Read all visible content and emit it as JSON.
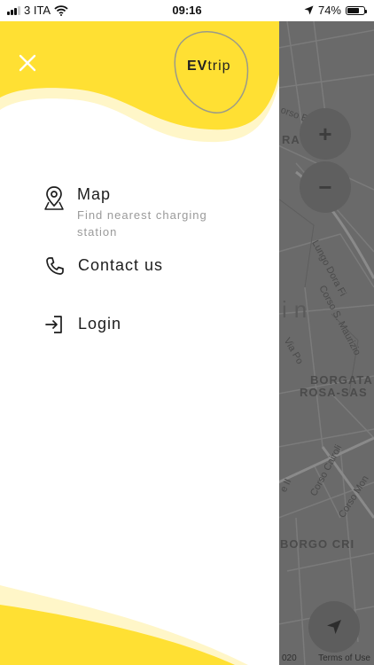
{
  "status_bar": {
    "carrier": "3 ITA",
    "time": "09:16",
    "battery": "74%",
    "battery_level": 0.74
  },
  "drawer": {
    "logo": {
      "prefix": "EV",
      "suffix": "trip"
    },
    "close_icon": "close-icon",
    "menu": [
      {
        "title": "Map",
        "subtitle": "Find nearest charging station",
        "icon": "map-pin-icon"
      },
      {
        "title": "Contact us",
        "icon": "phone-icon"
      },
      {
        "title": "Login",
        "icon": "login-icon"
      }
    ]
  },
  "map": {
    "labels": {
      "corso_br": "orso Br",
      "ra": "RA",
      "lungo_dora": "Lungo Dora Fi",
      "corso_s_maurizio": "Corso S. Maurizio",
      "in": "in",
      "via_po": "Via Po",
      "borgata": "BORGATA",
      "rosa_sas": "ROSA-SAS",
      "corso_cairoli": "Corso Cairoli",
      "corso_mon": "Corso Mon",
      "e_ii": "e II",
      "borgo_cri": "BORGO CRI"
    },
    "zoom_in": "+",
    "zoom_out": "−",
    "copyright_fragment": "020",
    "terms": "Terms of Use"
  },
  "colors": {
    "accent": "#FFE033",
    "accent_light": "#FFF6C8",
    "map_bg": "#6a6a6a"
  }
}
